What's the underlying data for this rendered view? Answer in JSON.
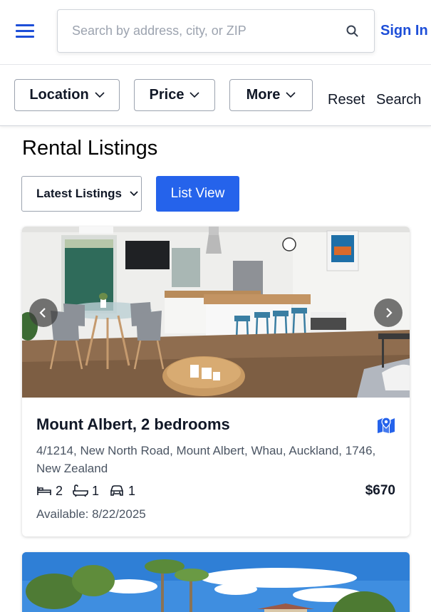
{
  "header": {
    "search_placeholder": "Search by address, city, or ZIP",
    "search_value": "",
    "sign_in_label": "Sign In"
  },
  "filters": {
    "location_label": "Location",
    "price_label": "Price",
    "more_label": "More",
    "reset_label": "Reset",
    "search_label": "Search"
  },
  "main": {
    "title": "Rental Listings",
    "sort_selected": "Latest Listings",
    "view_toggle_label": "List View"
  },
  "listings": [
    {
      "title": "Mount Albert, 2 bedrooms",
      "address": "4/1214, New North Road, Mount Albert, Whau, Auckland, 1746, New Zealand",
      "bedrooms": "2",
      "bathrooms": "1",
      "parking": "1",
      "price": "$670",
      "available": "Available: 8/22/2025"
    }
  ],
  "colors": {
    "accent": "#2563eb",
    "link": "#1d4ed8"
  },
  "icons": [
    "menu-icon",
    "search-icon",
    "chevron-down-icon",
    "chevron-left-icon",
    "chevron-right-icon",
    "map-icon",
    "bed-icon",
    "bath-icon",
    "car-icon"
  ]
}
